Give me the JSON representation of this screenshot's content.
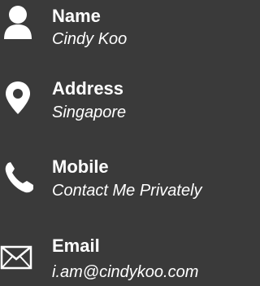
{
  "contact": {
    "name": {
      "icon": "person-icon",
      "label": "Name",
      "value": "Cindy Koo"
    },
    "address": {
      "icon": "map-pin-icon",
      "label": "Address",
      "value": "Singapore"
    },
    "mobile": {
      "icon": "phone-icon",
      "label": "Mobile",
      "value": "Contact Me Privately"
    },
    "email": {
      "icon": "envelope-icon",
      "label": "Email",
      "value": "i.am@cindykoo.com"
    }
  },
  "colors": {
    "background": "#3a3a3a",
    "text": "#ffffff"
  }
}
